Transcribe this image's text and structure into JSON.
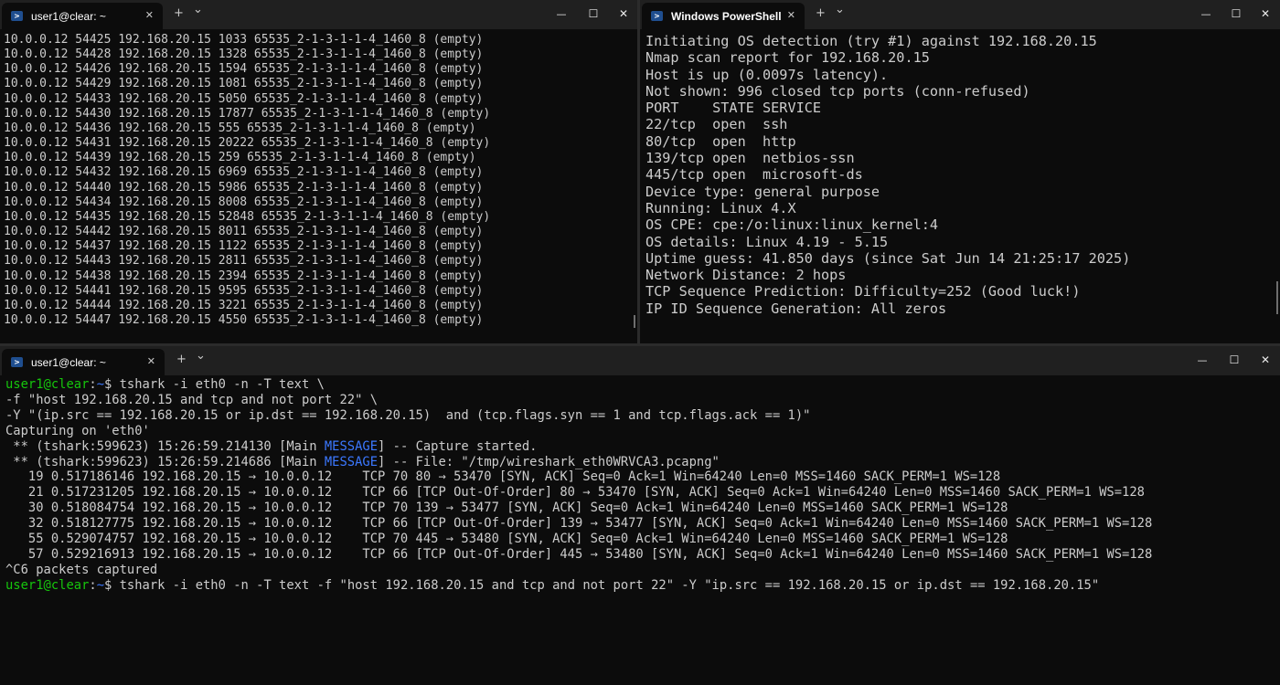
{
  "windows": {
    "top_left": {
      "tab_title": "user1@clear: ~",
      "lines": [
        "10.0.0.12 54425 192.168.20.15 1033 65535_2-1-3-1-1-4_1460_8 (empty)",
        "10.0.0.12 54428 192.168.20.15 1328 65535_2-1-3-1-1-4_1460_8 (empty)",
        "10.0.0.12 54426 192.168.20.15 1594 65535_2-1-3-1-1-4_1460_8 (empty)",
        "10.0.0.12 54429 192.168.20.15 1081 65535_2-1-3-1-1-4_1460_8 (empty)",
        "10.0.0.12 54433 192.168.20.15 5050 65535_2-1-3-1-1-4_1460_8 (empty)",
        "10.0.0.12 54430 192.168.20.15 17877 65535_2-1-3-1-1-4_1460_8 (empty)",
        "10.0.0.12 54436 192.168.20.15 555 65535_2-1-3-1-1-4_1460_8 (empty)",
        "10.0.0.12 54431 192.168.20.15 20222 65535_2-1-3-1-1-4_1460_8 (empty)",
        "10.0.0.12 54439 192.168.20.15 259 65535_2-1-3-1-1-4_1460_8 (empty)",
        "10.0.0.12 54432 192.168.20.15 6969 65535_2-1-3-1-1-4_1460_8 (empty)",
        "10.0.0.12 54440 192.168.20.15 5986 65535_2-1-3-1-1-4_1460_8 (empty)",
        "10.0.0.12 54434 192.168.20.15 8008 65535_2-1-3-1-1-4_1460_8 (empty)",
        "10.0.0.12 54435 192.168.20.15 52848 65535_2-1-3-1-1-4_1460_8 (empty)",
        "10.0.0.12 54442 192.168.20.15 8011 65535_2-1-3-1-1-4_1460_8 (empty)",
        "10.0.0.12 54437 192.168.20.15 1122 65535_2-1-3-1-1-4_1460_8 (empty)",
        "10.0.0.12 54443 192.168.20.15 2811 65535_2-1-3-1-1-4_1460_8 (empty)",
        "10.0.0.12 54438 192.168.20.15 2394 65535_2-1-3-1-1-4_1460_8 (empty)",
        "10.0.0.12 54441 192.168.20.15 9595 65535_2-1-3-1-1-4_1460_8 (empty)",
        "10.0.0.12 54444 192.168.20.15 3221 65535_2-1-3-1-1-4_1460_8 (empty)",
        "10.0.0.12 54447 192.168.20.15 4550 65535_2-1-3-1-1-4_1460_8 (empty)"
      ]
    },
    "top_right": {
      "tab_title": "Windows PowerShell",
      "lines": [
        "Initiating OS detection (try #1) against 192.168.20.15",
        "Nmap scan report for 192.168.20.15",
        "Host is up (0.0097s latency).",
        "Not shown: 996 closed tcp ports (conn-refused)",
        "PORT    STATE SERVICE",
        "22/tcp  open  ssh",
        "80/tcp  open  http",
        "139/tcp open  netbios-ssn",
        "445/tcp open  microsoft-ds",
        "Device type: general purpose",
        "Running: Linux 4.X",
        "OS CPE: cpe:/o:linux:linux_kernel:4",
        "OS details: Linux 4.19 - 5.15",
        "Uptime guess: 41.850 days (since Sat Jun 14 21:25:17 2025)",
        "Network Distance: 2 hops",
        "TCP Sequence Prediction: Difficulty=252 (Good luck!)",
        "IP ID Sequence Generation: All zeros"
      ]
    },
    "bottom": {
      "tab_title": "user1@clear: ~",
      "prompt_user": "user1@clear",
      "prompt_sep": ":",
      "prompt_path": "~",
      "prompt_dollar": "$ ",
      "command_1": "tshark -i eth0 -n -T text \\",
      "command_1_cont": [
        "-f \"host 192.168.20.15 and tcp and not port 22\" \\",
        "-Y \"(ip.src == 192.168.20.15 or ip.dst == 192.168.20.15)  and (tcp.flags.syn == 1 and tcp.flags.ack == 1)\"",
        "Capturing on 'eth0'"
      ],
      "messages": [
        {
          "prefix": " ** (tshark:599623) 15:26:59.214130 [Main ",
          "keyword": "MESSAGE",
          "suffix": "] -- Capture started."
        },
        {
          "prefix": " ** (tshark:599623) 15:26:59.214686 [Main ",
          "keyword": "MESSAGE",
          "suffix": "] -- File: \"/tmp/wireshark_eth0WRVCA3.pcapng\""
        }
      ],
      "packets": [
        "   19 0.517186146 192.168.20.15 → 10.0.0.12    TCP 70 80 → 53470 [SYN, ACK] Seq=0 Ack=1 Win=64240 Len=0 MSS=1460 SACK_PERM=1 WS=128",
        "   21 0.517231205 192.168.20.15 → 10.0.0.12    TCP 66 [TCP Out-Of-Order] 80 → 53470 [SYN, ACK] Seq=0 Ack=1 Win=64240 Len=0 MSS=1460 SACK_PERM=1 WS=128",
        "   30 0.518084754 192.168.20.15 → 10.0.0.12    TCP 70 139 → 53477 [SYN, ACK] Seq=0 Ack=1 Win=64240 Len=0 MSS=1460 SACK_PERM=1 WS=128",
        "   32 0.518127775 192.168.20.15 → 10.0.0.12    TCP 66 [TCP Out-Of-Order] 139 → 53477 [SYN, ACK] Seq=0 Ack=1 Win=64240 Len=0 MSS=1460 SACK_PERM=1 WS=128",
        "   55 0.529074757 192.168.20.15 → 10.0.0.12    TCP 70 445 → 53480 [SYN, ACK] Seq=0 Ack=1 Win=64240 Len=0 MSS=1460 SACK_PERM=1 WS=128",
        "   57 0.529216913 192.168.20.15 → 10.0.0.12    TCP 66 [TCP Out-Of-Order] 445 → 53480 [SYN, ACK] Seq=0 Ack=1 Win=64240 Len=0 MSS=1460 SACK_PERM=1 WS=128"
      ],
      "summary": "^C6 packets captured",
      "command_2": "tshark -i eth0 -n -T text -f \"host 192.168.20.15 and tcp and not port 22\" -Y \"ip.src == 192.168.20.15 or ip.dst == 192.168.20.15\""
    }
  },
  "titlebar_glyphs": {
    "close": "✕",
    "new_tab": "+",
    "dropdown": "⌄",
    "minimize": "—",
    "maximize": "☐",
    "window_close": "✕"
  },
  "colors": {
    "background": "#0c0c0c",
    "titlebar": "#202020",
    "text": "#cccccc",
    "prompt_user": "#16c60c",
    "prompt_path": "#3b78ff"
  }
}
